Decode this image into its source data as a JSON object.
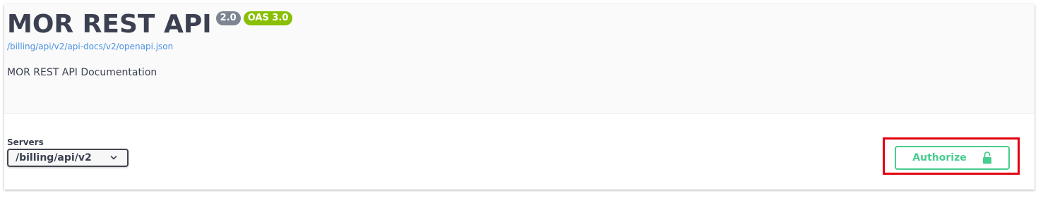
{
  "info": {
    "title": "MOR REST API",
    "version_badge": "2.0",
    "oas_badge": "OAS 3.0",
    "spec_url": "/billing/api/v2/api-docs/v2/openapi.json",
    "description": "MOR REST API Documentation"
  },
  "servers": {
    "label": "Servers",
    "selected": "/billing/api/v2",
    "dropdown_icon": "chevron-down-icon"
  },
  "auth": {
    "button_label": "Authorize",
    "icon": "lock-open-icon"
  },
  "colors": {
    "title_text": "#3b4151",
    "version_badge": "#7d8492",
    "oas_badge": "#89bf04",
    "link": "#4990e2",
    "authorize_accent": "#49cc90",
    "highlight_box": "#e3000f"
  }
}
